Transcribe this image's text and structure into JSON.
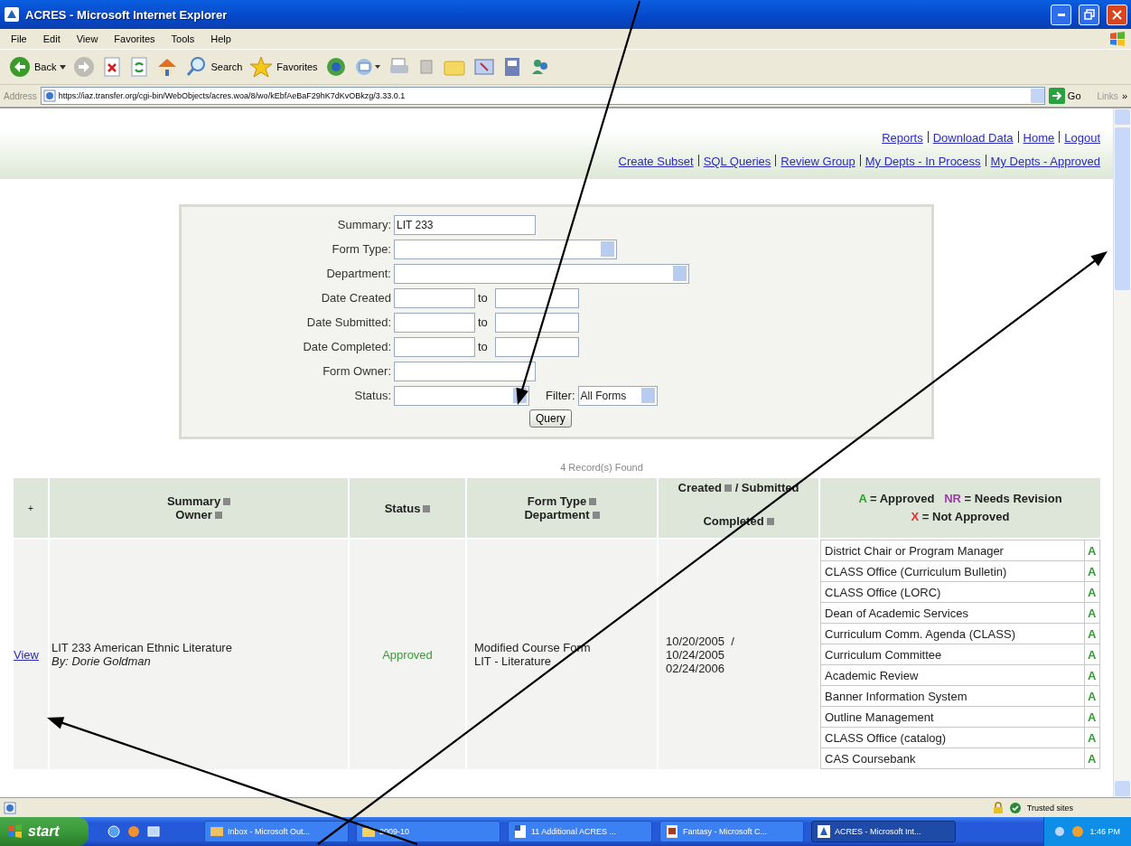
{
  "window": {
    "title": "ACRES - Microsoft Internet Explorer"
  },
  "menu": [
    "File",
    "Edit",
    "View",
    "Favorites",
    "Tools",
    "Help"
  ],
  "toolbar": {
    "back": "Back",
    "search": "Search",
    "favorites": "Favorites"
  },
  "address_bar": {
    "label": "Address",
    "value": "https://iaz.transfer.org/cgi-bin/WebObjects/acres.woa/8/wo/kEbfAeBaF29hK7dKvOBkzg/3.33.0.1",
    "go": "Go",
    "links": "Links",
    "more": "»"
  },
  "page": {
    "top_links": [
      [
        "Reports",
        "Download Data",
        "Home",
        "Logout"
      ],
      [
        "Create Subset",
        "SQL Queries",
        "Review Group",
        "My Depts - In Process",
        "My Depts - Approved"
      ]
    ],
    "search_form": {
      "fields": [
        {
          "kind": "text",
          "label": "Summary:",
          "value": "LIT 233"
        },
        {
          "kind": "select",
          "label": "Form Type:"
        },
        {
          "kind": "select_wide",
          "label": "Department:"
        },
        {
          "kind": "range",
          "label": "Date Created",
          "joiner": "to"
        },
        {
          "kind": "range",
          "label": "Date Submitted:",
          "joiner": "to"
        },
        {
          "kind": "range",
          "label": "Date Completed:",
          "joiner": "to"
        },
        {
          "kind": "text",
          "label": "Form Owner:"
        },
        {
          "kind": "status_filter",
          "label": "Status:",
          "filter_label": "Filter:",
          "filter_value": "All Forms"
        }
      ],
      "button": "Query"
    },
    "records_found": "4 Record(s) Found",
    "table": {
      "columns": [
        {
          "lines": [
            {
              "text": "+",
              "sort": false
            }
          ]
        },
        {
          "lines": [
            {
              "text": "Summary",
              "sort": true
            },
            {
              "text": "Owner",
              "sort": true
            }
          ]
        },
        {
          "lines": [
            {
              "text": "Status",
              "sort": true
            }
          ]
        },
        {
          "lines": [
            {
              "text": "Form Type",
              "sort": true
            },
            {
              "text": "Department",
              "sort": true
            }
          ]
        },
        {
          "lines": [
            {
              "text": "Created",
              "sort": true,
              "suffix": "/ Submitted"
            },
            {
              "text": "Completed",
              "sort": true
            }
          ]
        }
      ],
      "legend": [
        [
          {
            "code": "A",
            "meaning": "= Approved",
            "color": "#2e9e2e"
          },
          {
            "code": "NR",
            "meaning": "= Needs Revision",
            "color": "#9a3aa8"
          }
        ],
        [
          {
            "code": "X",
            "meaning": "= Not Approved",
            "color": "#e03030"
          }
        ]
      ],
      "rows": [
        {
          "link": "View",
          "summary": "LIT 233 American Ethnic Literature",
          "owner": "By: Dorie Goldman",
          "status": {
            "text": "Approved",
            "color": "#3a9a3a"
          },
          "form_type": "Modified Course Form",
          "department": "LIT - Literature",
          "dates": [
            "10/20/2005  /",
            "10/24/2005",
            "02/24/2006"
          ],
          "approvals": [
            {
              "step": "District Chair or Program Manager",
              "code": "A",
              "color": "#2e9e2e"
            },
            {
              "step": "CLASS Office (Curriculum Bulletin)",
              "code": "A",
              "color": "#2e9e2e"
            },
            {
              "step": "CLASS Office (LORC)",
              "code": "A",
              "color": "#2e9e2e"
            },
            {
              "step": "Dean of Academic Services",
              "code": "A",
              "color": "#2e9e2e"
            },
            {
              "step": "Curriculum Comm. Agenda (CLASS)",
              "code": "A",
              "color": "#2e9e2e"
            },
            {
              "step": "Curriculum Committee",
              "code": "A",
              "color": "#2e9e2e"
            },
            {
              "step": "Academic Review",
              "code": "A",
              "color": "#2e9e2e"
            },
            {
              "step": "Banner Information System",
              "code": "A",
              "color": "#2e9e2e"
            },
            {
              "step": "Outline Management",
              "code": "A",
              "color": "#2e9e2e"
            },
            {
              "step": "CLASS Office (catalog)",
              "code": "A",
              "color": "#2e9e2e"
            },
            {
              "step": "CAS Coursebank",
              "code": "A",
              "color": "#2e9e2e"
            }
          ]
        }
      ]
    }
  },
  "status_bar": {
    "zone": "Trusted sites"
  },
  "taskbar": {
    "start": "start",
    "items": [
      {
        "label": "Inbox - Microsoft Out...",
        "selected": false
      },
      {
        "label": "2009-10",
        "selected": false
      },
      {
        "label": "11 Additional ACRES ...",
        "selected": false
      },
      {
        "label": "Fantasy - Microsoft C...",
        "selected": false
      },
      {
        "label": "ACRES - Microsoft Int...",
        "selected": true
      }
    ],
    "clock": "1:46 PM"
  }
}
